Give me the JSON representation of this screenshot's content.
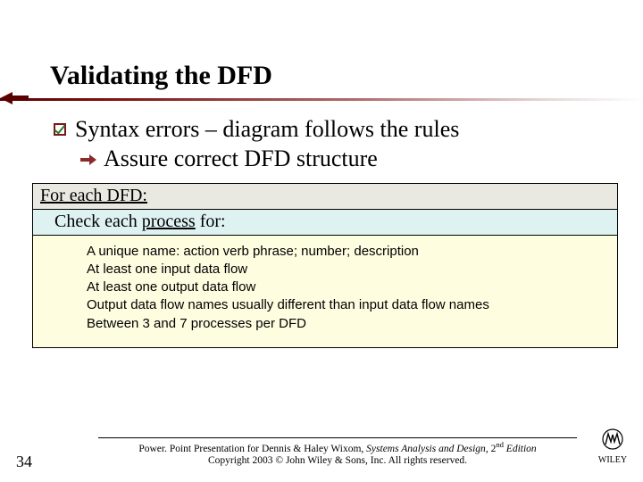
{
  "title": "Validating the DFD",
  "bullets": {
    "b1": "Syntax errors – diagram follows the rules",
    "b2": "Assure correct DFD structure"
  },
  "box": {
    "row1_a": "For each DFD:",
    "row2_a": "Check each ",
    "row2_b": "process",
    "row2_c": " for:",
    "items": [
      "A unique name: action verb phrase; number; description",
      "At least one input data flow",
      "At least one output data flow",
      "Output data flow names usually different than input data flow names",
      "Between 3 and 7 processes per DFD"
    ]
  },
  "footer": {
    "page": "34",
    "line1_a": "Power. Point Presentation for Dennis & Haley Wixom, ",
    "line1_b": "Systems Analysis and Design",
    "line1_c": ", 2",
    "line1_d": "nd",
    "line1_e": " Edition",
    "line2": "Copyright 2003 © John Wiley & Sons, Inc. All rights reserved.",
    "publisher": "WILEY"
  }
}
